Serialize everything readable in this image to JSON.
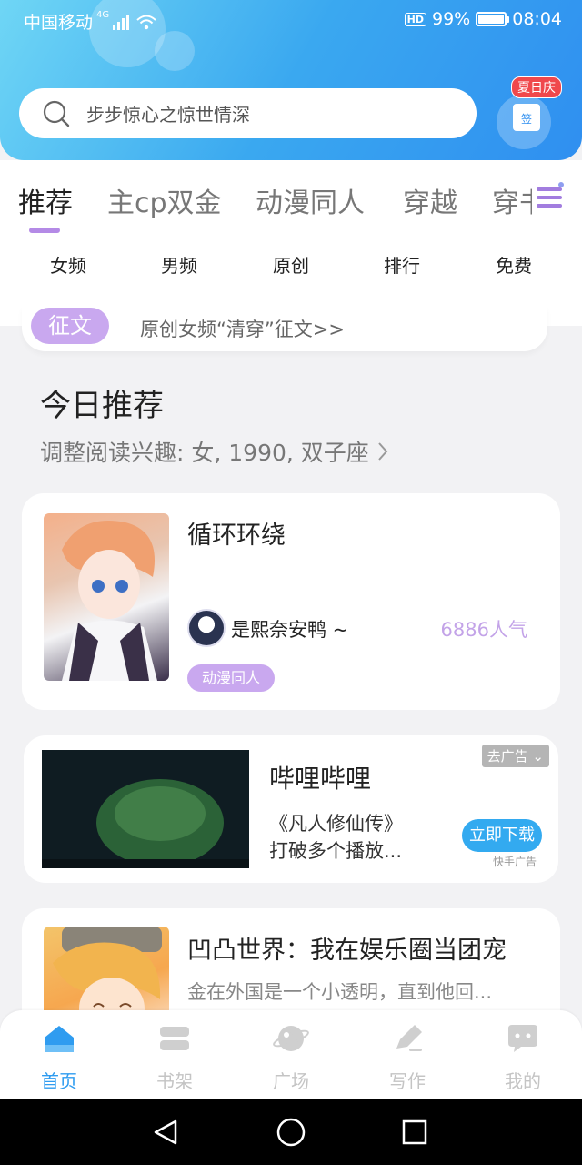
{
  "status_bar": {
    "carrier": "中国移动",
    "network": "4G",
    "battery": "99%",
    "battery_level": 0.99,
    "time": "08:04",
    "hd": "HD"
  },
  "search": {
    "placeholder": "步步惊心之惊世情深"
  },
  "signin": {
    "tag": "夏日庆",
    "label": "签"
  },
  "tabs": [
    "推荐",
    "主cp双金",
    "动漫同人",
    "穿越",
    "穿书"
  ],
  "active_tab": "推荐",
  "subtabs": [
    "女频",
    "男频",
    "原创",
    "排行",
    "免费"
  ],
  "notice": {
    "tag": "征文",
    "text": "原创女频“清穿”征文>>"
  },
  "section": {
    "title": "今日推荐",
    "subtitle": "调整阅读兴趣: 女, 1990, 双子座"
  },
  "books": [
    {
      "title": "循环环绕",
      "author": "是熙奈安鸭 ~",
      "popularity": "6886人气",
      "tag": "动漫同人"
    },
    {
      "title": "凹凸世界：我在娱乐圈当团宠",
      "description": "金在外国是一个小透明，直到他回..."
    }
  ],
  "ad": {
    "title": "哔哩哔哩",
    "description_line1": "《凡人修仙传》",
    "description_line2": "打破多个播放...",
    "badge": "去广告",
    "button": "立即下载",
    "source": "快手广告"
  },
  "bottom_nav": [
    {
      "label": "首页",
      "icon": "home-icon",
      "active": true
    },
    {
      "label": "书架",
      "icon": "bookshelf-icon",
      "active": false
    },
    {
      "label": "广场",
      "icon": "planet-icon",
      "active": false
    },
    {
      "label": "写作",
      "icon": "pen-icon",
      "active": false
    },
    {
      "label": "我的",
      "icon": "chat-bubble-icon",
      "active": false
    }
  ],
  "colors": {
    "accent": "#b48ae6",
    "blue": "#2f9cf0",
    "header_start": "#6fd6f5",
    "header_end": "#2f8ff0"
  }
}
